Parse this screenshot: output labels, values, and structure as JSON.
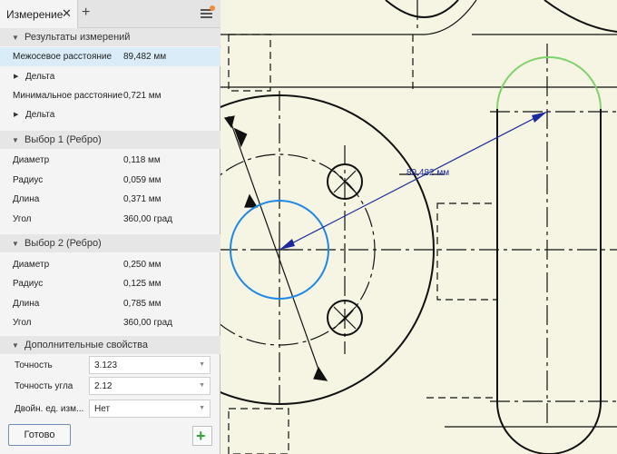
{
  "panel": {
    "tab_label": "Измерение",
    "sections": {
      "results": "Результаты измерений",
      "selection1": "Выбор 1 (Ребро)",
      "selection2": "Выбор 2 (Ребро)",
      "extra": "Дополнительные свойства"
    },
    "results": {
      "center_distance": {
        "label": "Межосевое расстояние",
        "value": "89,482 мм"
      },
      "delta1": "Дельта",
      "min_distance": {
        "label": "Минимальное расстояние",
        "value": "0,721 мм"
      },
      "delta2": "Дельта"
    },
    "selection1": [
      {
        "label": "Диаметр",
        "value": "0,118 мм"
      },
      {
        "label": "Радиус",
        "value": "0,059 мм"
      },
      {
        "label": "Длина",
        "value": "0,371 мм"
      },
      {
        "label": "Угол",
        "value": "360,00 град"
      }
    ],
    "selection2": [
      {
        "label": "Диаметр",
        "value": "0,250 мм"
      },
      {
        "label": "Радиус",
        "value": "0,125 мм"
      },
      {
        "label": "Длина",
        "value": "0,785 мм"
      },
      {
        "label": "Угол",
        "value": "360,00 град"
      }
    ],
    "extra": [
      {
        "label": "Точность",
        "value": "3.123"
      },
      {
        "label": "Точность угла",
        "value": "2.12"
      },
      {
        "label": "Двойн. ед. изм...",
        "value": "Нет"
      }
    ],
    "done_label": "Готово"
  },
  "canvas": {
    "dimension_label": "89,482 мм",
    "colors": {
      "background": "#f6f4e3",
      "geometry": "#111111",
      "selected_circle": "#1e88e5",
      "selected_arc": "#7ed36a",
      "dimension": "#1a2a9c"
    }
  }
}
